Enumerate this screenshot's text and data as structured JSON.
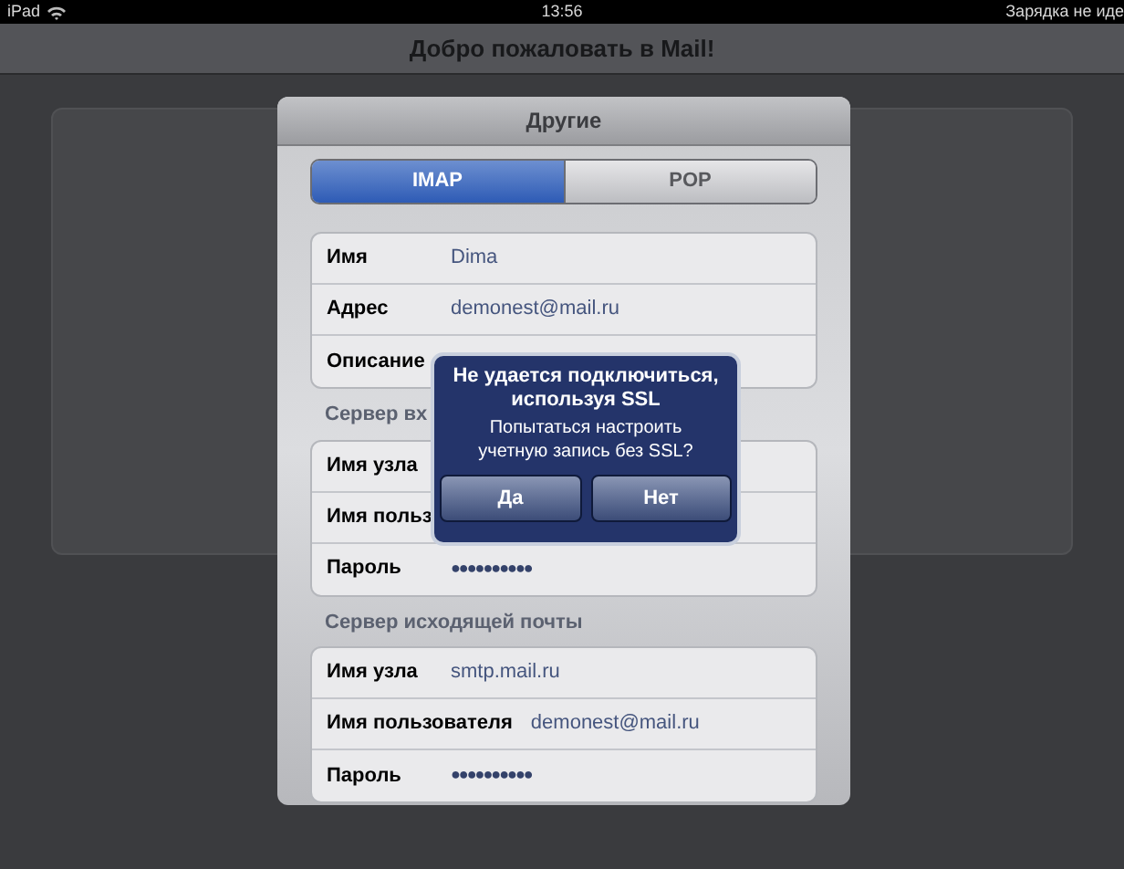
{
  "status_bar": {
    "device": "iPad",
    "time": "13:56",
    "battery": "Зарядка не иде"
  },
  "window": {
    "title": "Добро пожаловать в Mail!"
  },
  "sheet": {
    "title": "Другие",
    "segments": [
      {
        "label": "IMAP",
        "selected": true
      },
      {
        "label": "POP",
        "selected": false
      }
    ],
    "groups": [
      {
        "rows": [
          {
            "label": "Имя",
            "value": "Dima",
            "kind": "text"
          },
          {
            "label": "Адрес",
            "value": "demonest@mail.ru",
            "kind": "text"
          },
          {
            "label": "Описание",
            "kind": "text"
          }
        ]
      },
      {
        "header": "Сервер вх",
        "rows": [
          {
            "label": "Имя узла",
            "kind": "text"
          },
          {
            "label": "Имя польз",
            "kind": "text"
          },
          {
            "label": "Пароль",
            "value": "●●●●●●●●●●",
            "kind": "password"
          }
        ]
      },
      {
        "header": "Сервер исходящей почты",
        "rows": [
          {
            "label": "Имя узла",
            "value": "smtp.mail.ru",
            "kind": "text"
          },
          {
            "label": "Имя пользователя",
            "value": "demonest@mail.ru",
            "kind": "text"
          },
          {
            "label": "Пароль",
            "value": "●●●●●●●●●●",
            "kind": "password"
          }
        ]
      }
    ]
  },
  "alert": {
    "title": "Не удается подключиться, используя SSL",
    "message": "Попытаться настроить учетную запись без SSL?",
    "buttons": [
      "Да",
      "Нет"
    ]
  }
}
